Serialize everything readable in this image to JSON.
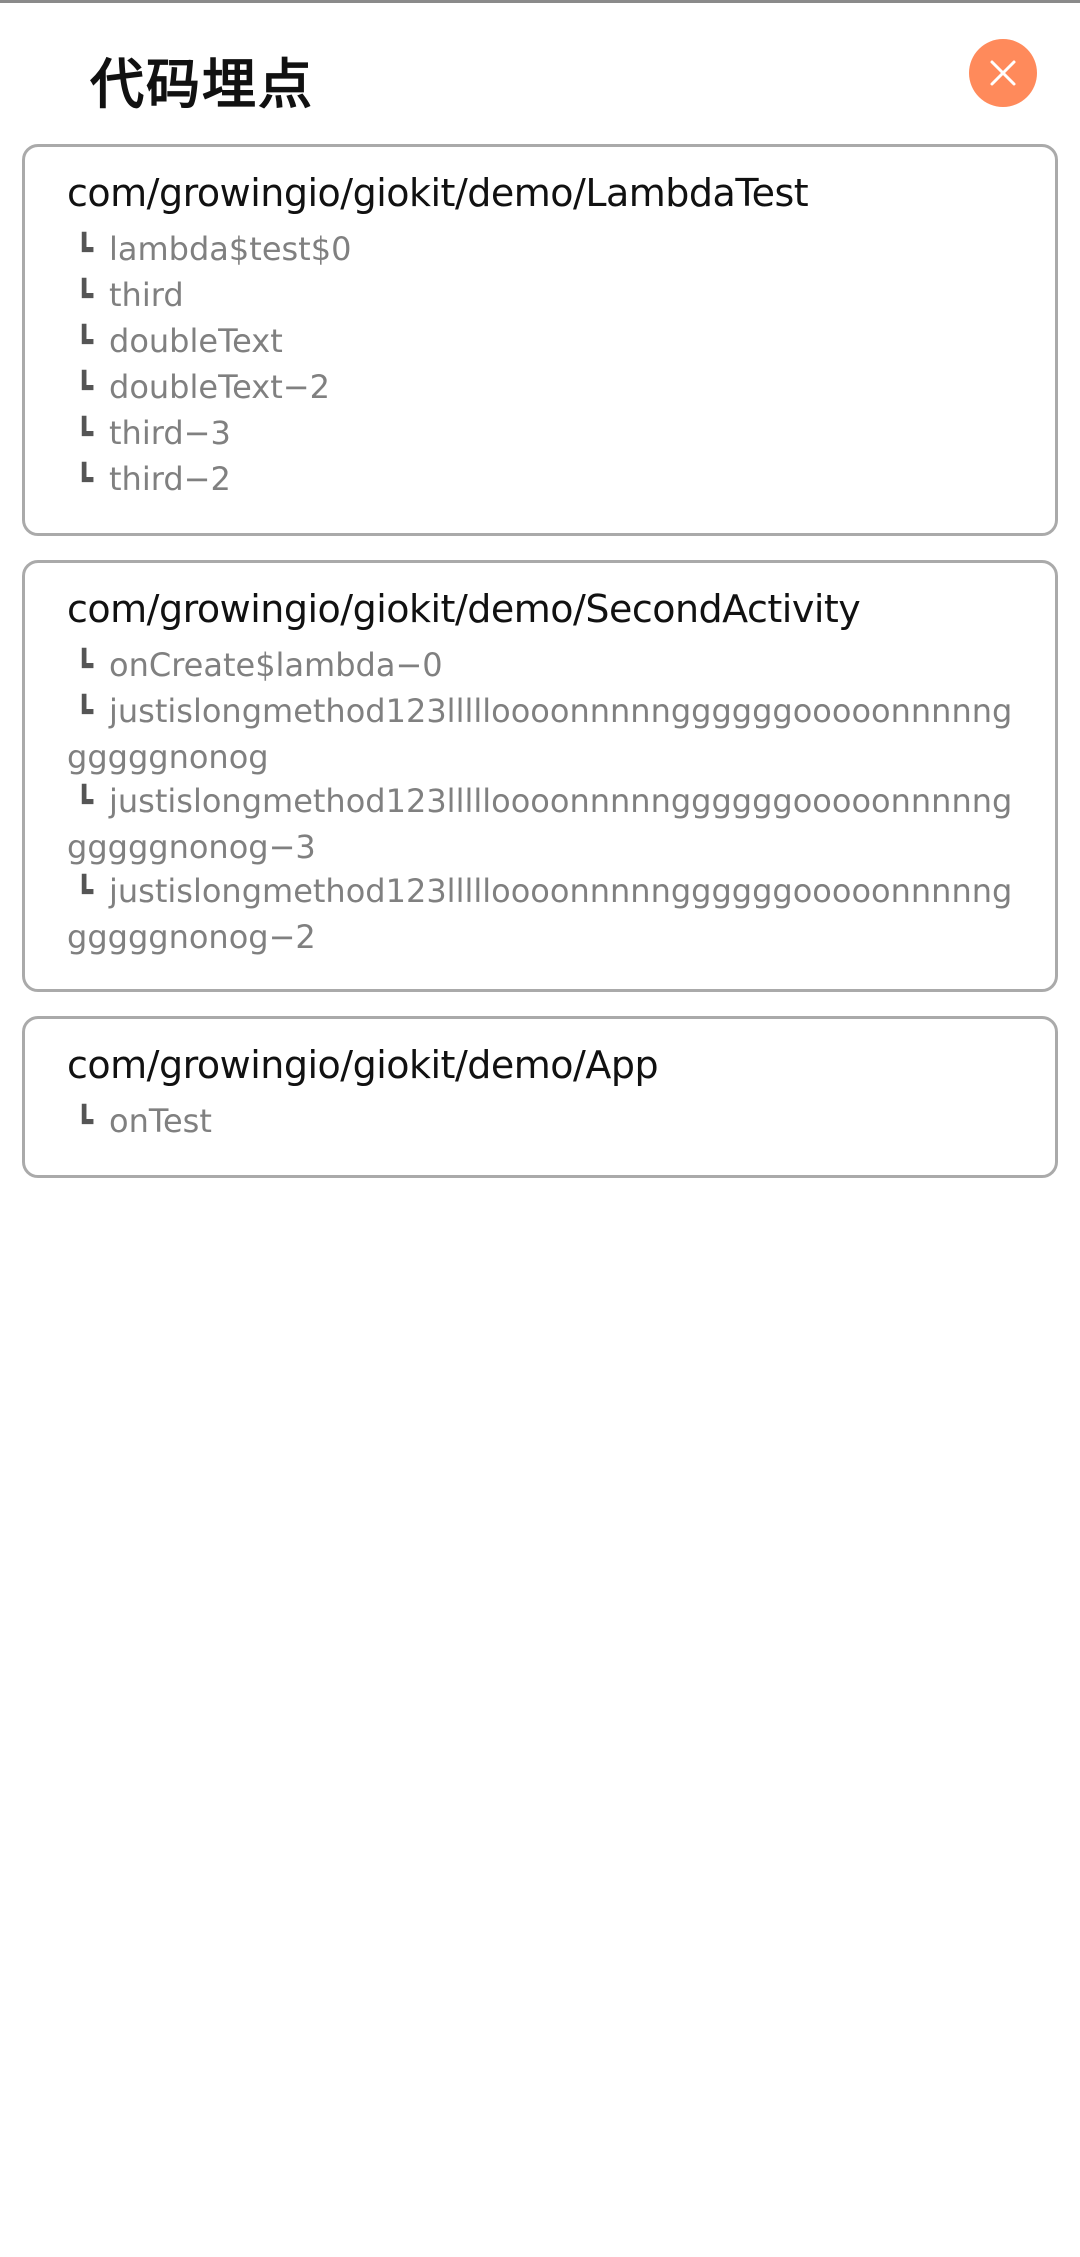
{
  "header": {
    "title": "代码埋点",
    "close_icon": "close-icon",
    "accent_color": "#ff8a5b"
  },
  "branch_glyph": "┗",
  "cards": [
    {
      "class_name": "com/growingio/giokit/demo/LambdaTest",
      "methods": [
        "lambda$test$0",
        "third",
        "doubleText",
        "doubleText−2",
        "third−3",
        "third−2"
      ]
    },
    {
      "class_name": "com/growingio/giokit/demo/SecondActivity",
      "methods": [
        "onCreate$lambda−0",
        "justislongmethod123llllloooonnnnnggggggooooonnnnnggggggnonog",
        "justislongmethod123llllloooonnnnnggggggooooonnnnnggggggnonog−3",
        "justislongmethod123llllloooonnnnnggggggooooonnnnnggggggnonog−2"
      ]
    },
    {
      "class_name": "com/growingio/giokit/demo/App",
      "methods": [
        "onTest"
      ]
    }
  ]
}
